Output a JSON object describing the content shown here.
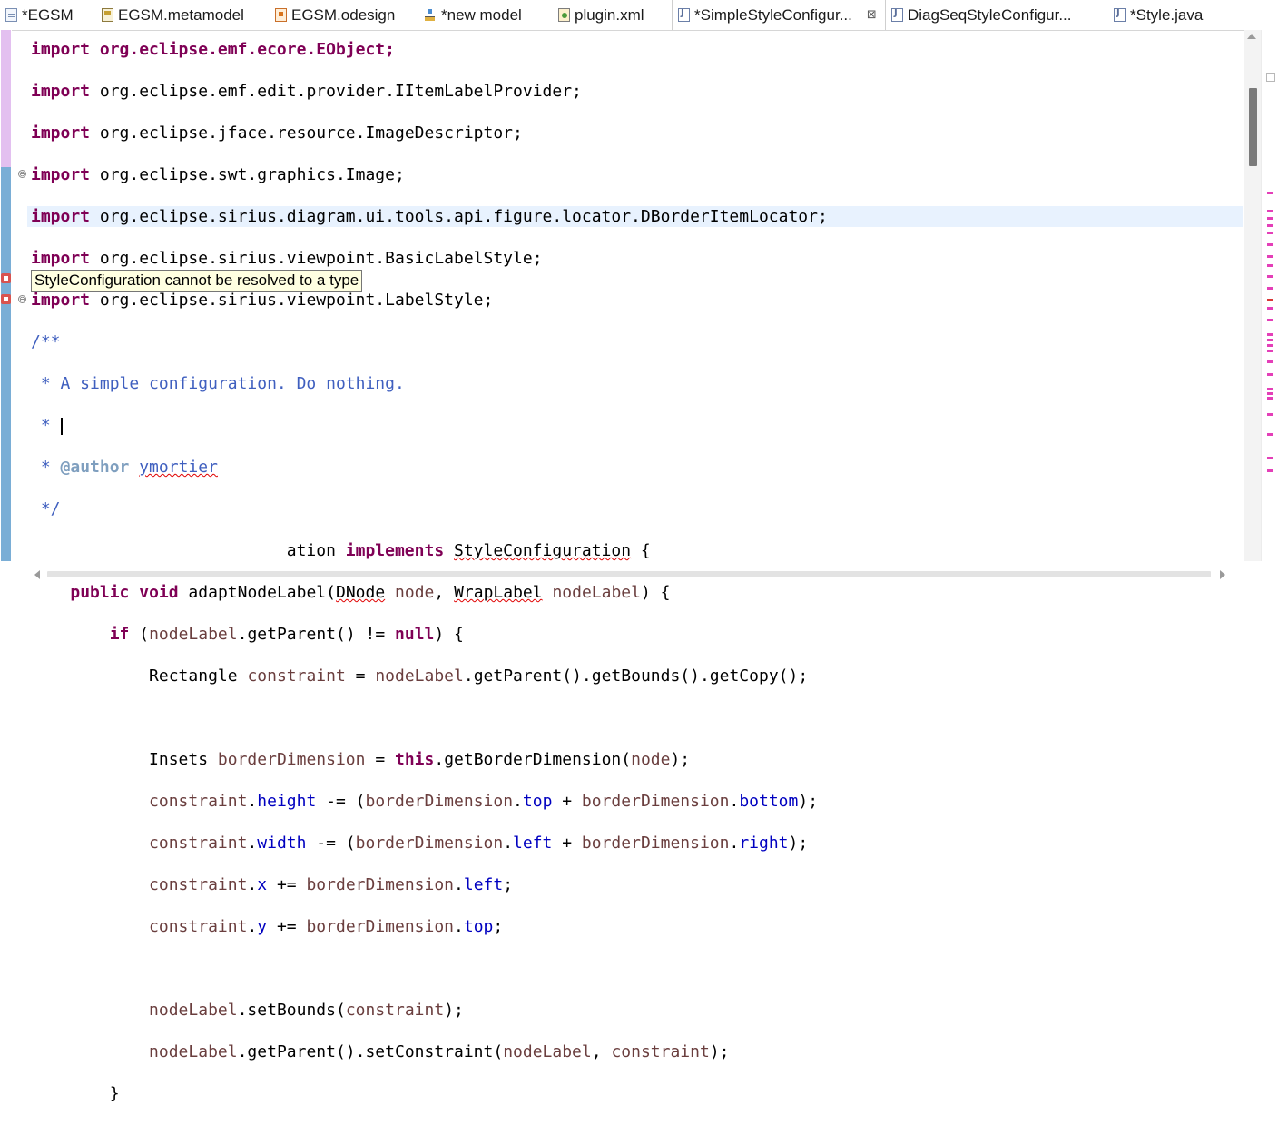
{
  "tabs": [
    {
      "label": "*EGSM",
      "icon": "diagram-file-icon"
    },
    {
      "label": "EGSM.metamodel",
      "icon": "metamodel-icon"
    },
    {
      "label": "EGSM.odesign",
      "icon": "odesign-icon"
    },
    {
      "label": "*new model",
      "icon": "model-icon"
    },
    {
      "label": "plugin.xml",
      "icon": "plugin-icon"
    },
    {
      "label": "*SimpleStyleConfigur...",
      "icon": "java-file-icon",
      "active": true
    },
    {
      "label": "DiagSeqStyleConfigur...",
      "icon": "java-file-icon"
    },
    {
      "label": "*Style.java",
      "icon": "java-file-icon"
    }
  ],
  "close_glyph": "⊠",
  "tooltip": "StyleConfiguration cannot be resolved to a type",
  "code": {
    "l0": "import org.eclipse.emf.ecore.EObject;",
    "l1_kw": "import",
    "l1_rest": " org.eclipse.emf.edit.provider.IItemLabelProvider;",
    "l2_kw": "import",
    "l2_rest": " org.eclipse.jface.resource.ImageDescriptor;",
    "l3_kw": "import",
    "l3_rest": " org.eclipse.swt.graphics.Image;",
    "l4_kw": "import",
    "l4_rest": " org.eclipse.sirius.diagram.ui.tools.api.figure.locator.DBorderItemLocator;",
    "l5_kw": "import",
    "l5_rest": " org.eclipse.sirius.viewpoint.BasicLabelStyle;",
    "l6_kw": "import",
    "l6_rest": " org.eclipse.sirius.viewpoint.LabelStyle;",
    "l7": "/**",
    "l8": " * A simple configuration. Do nothing.",
    "l9": " * ",
    "l10_star": " * ",
    "l10_tag": "@author",
    "l10_space": " ",
    "l10_name": "ymortier",
    "l11": " */",
    "l12_pre": "                          ation ",
    "l12_kw": "implements",
    "l12_sp": " ",
    "l12_type": "StyleConfiguration",
    "l12_end": " {",
    "l13_ind": "    ",
    "l13_kw1": "public",
    "l13_sp1": " ",
    "l13_kw2": "void",
    "l13_name": " adaptNodeLabel(",
    "l13_t1": "DNode",
    "l13_sp2": " ",
    "l13_p1": "node",
    "l13_comma": ", ",
    "l13_t2": "WrapLabel",
    "l13_sp3": " ",
    "l13_p2": "nodeLabel",
    "l13_end": ") {",
    "l14_ind": "        ",
    "l14_kw": "if",
    "l14_a": " (",
    "l14_v": "nodeLabel",
    "l14_b": ".getParent() != ",
    "l14_null": "null",
    "l14_c": ") {",
    "l15_ind": "            ",
    "l15_t": "Rectangle",
    "l15_sp": " ",
    "l15_v1": "constraint",
    "l15_eq": " = ",
    "l15_v2": "nodeLabel",
    "l15_rest": ".getParent().getBounds().getCopy();",
    "l17_ind": "            ",
    "l17_t": "Insets",
    "l17_sp": " ",
    "l17_v1": "borderDimension",
    "l17_eq": " = ",
    "l17_kw": "this",
    "l17_m": ".getBorderDimension(",
    "l17_v2": "node",
    "l17_end": ");",
    "l18_ind": "            ",
    "l18_v": "constraint",
    "l18_dot": ".",
    "l18_f": "height",
    "l18_op": " -= (",
    "l18_v2": "borderDimension",
    "l18_dot2": ".",
    "l18_f2": "top",
    "l18_plus": " + ",
    "l18_v3": "borderDimension",
    "l18_dot3": ".",
    "l18_f3": "bottom",
    "l18_end": ");",
    "l19_ind": "            ",
    "l19_v": "constraint",
    "l19_dot": ".",
    "l19_f": "width",
    "l19_op": " -= (",
    "l19_v2": "borderDimension",
    "l19_dot2": ".",
    "l19_f2": "left",
    "l19_plus": " + ",
    "l19_v3": "borderDimension",
    "l19_dot3": ".",
    "l19_f3": "right",
    "l19_end": ");",
    "l20_ind": "            ",
    "l20_v": "constraint",
    "l20_dot": ".",
    "l20_f": "x",
    "l20_op": " += ",
    "l20_v2": "borderDimension",
    "l20_dot2": ".",
    "l20_f2": "left",
    "l20_end": ";",
    "l21_ind": "            ",
    "l21_v": "constraint",
    "l21_dot": ".",
    "l21_f": "y",
    "l21_op": " += ",
    "l21_v2": "borderDimension",
    "l21_dot2": ".",
    "l21_f2": "top",
    "l21_end": ";",
    "l23_ind": "            ",
    "l23_v": "nodeLabel",
    "l23_m": ".setBounds(",
    "l23_v2": "constraint",
    "l23_end": ");",
    "l24_ind": "            ",
    "l24_v": "nodeLabel",
    "l24_m": ".getParent().setConstraint(",
    "l24_v2": "nodeLabel",
    "l24_comma": ", ",
    "l24_v3": "constraint",
    "l24_end": ");",
    "l25": "        }"
  },
  "fold_glyph": "⊖",
  "colors": {
    "keyword": "#7f0055",
    "comment": "#3f5fbf",
    "javadoc_tag": "#7f9fbf",
    "field": "#0000c0",
    "local_variable": "#6a3e3e",
    "current_line": "#e8f2fe",
    "tooltip_bg": "#ffffe1",
    "error": "#e00000"
  }
}
